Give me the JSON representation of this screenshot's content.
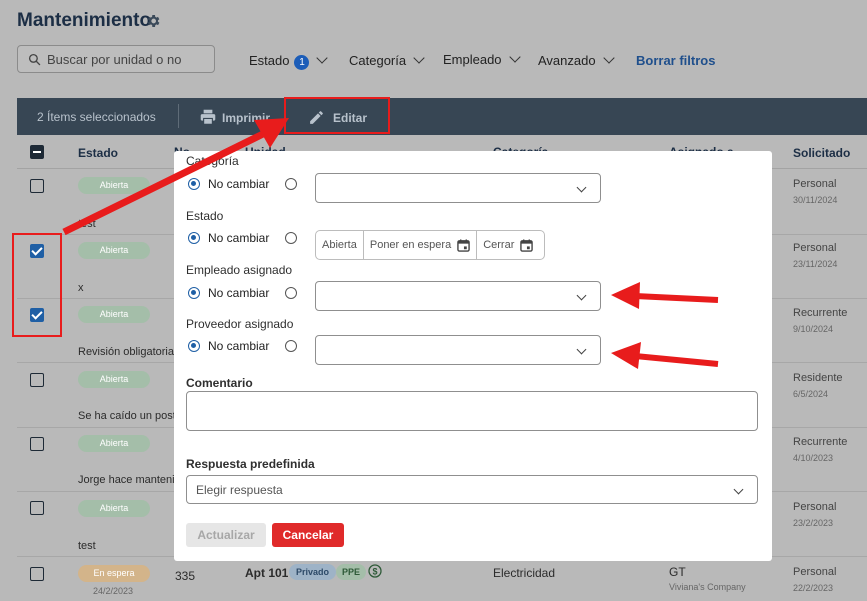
{
  "page": {
    "title": "Mantenimiento"
  },
  "search": {
    "placeholder": "Buscar por unidad o no"
  },
  "filters": {
    "estado": "Estado",
    "estado_count": "1",
    "categoria": "Categoría",
    "empleado": "Empleado",
    "avanzado": "Avanzado",
    "clear": "Borrar filtros"
  },
  "action_bar": {
    "selected": "2 Ítems seleccionados",
    "print": "Imprimir",
    "edit": "Editar"
  },
  "table": {
    "headers": {
      "estado": "Estado",
      "no": "No",
      "unidad": "Unidad",
      "categoria": "Categoría",
      "asignado": "Asignado a",
      "solicitado": "Solicitado"
    },
    "rows": [
      {
        "status": "Abierta",
        "desc": "test",
        "sol": "Personal",
        "date": "30/11/2024"
      },
      {
        "status": "Abierta",
        "desc": "x",
        "sol": "Personal",
        "date": "23/11/2024"
      },
      {
        "status": "Abierta",
        "desc": "Revisión obligatoria.",
        "sol": "Recurrente",
        "date": "9/10/2024"
      },
      {
        "status": "Abierta",
        "desc": "Se ha caído un poste",
        "sol": "Residente",
        "date": "6/5/2024"
      },
      {
        "status": "Abierta",
        "desc": "Jorge hace mantenim",
        "sol": "Recurrente",
        "date": "4/10/2023"
      },
      {
        "status": "Abierta",
        "desc": "test",
        "sol": "Personal",
        "date": "23/2/2023"
      },
      {
        "status": "En espera",
        "status_date": "24/2/2023",
        "no": "335",
        "unit": "Apt 101",
        "tag1": "Privado",
        "tag2": "PPE",
        "category": "Electricidad",
        "assignee": "GT",
        "assignee_company": "Viviana's Company",
        "sol": "Personal",
        "date": "22/2/2023"
      }
    ]
  },
  "modal": {
    "categoria_label": "Categoría",
    "estado_label": "Estado",
    "empleado_label": "Empleado asignado",
    "proveedor_label": "Proveedor asignado",
    "no_change": "No cambiar",
    "estado_options": [
      "Abierta",
      "Poner en espera",
      "Cerrar"
    ],
    "comentario_label": "Comentario",
    "respuesta_label": "Respuesta predefinida",
    "respuesta_placeholder": "Elegir respuesta",
    "update": "Actualizar",
    "cancel": "Cancelar"
  },
  "colors": {
    "accent": "#1f5fa5",
    "danger": "#e02a2a",
    "annotation": "#e81c1c",
    "action_bar": "#374654"
  }
}
